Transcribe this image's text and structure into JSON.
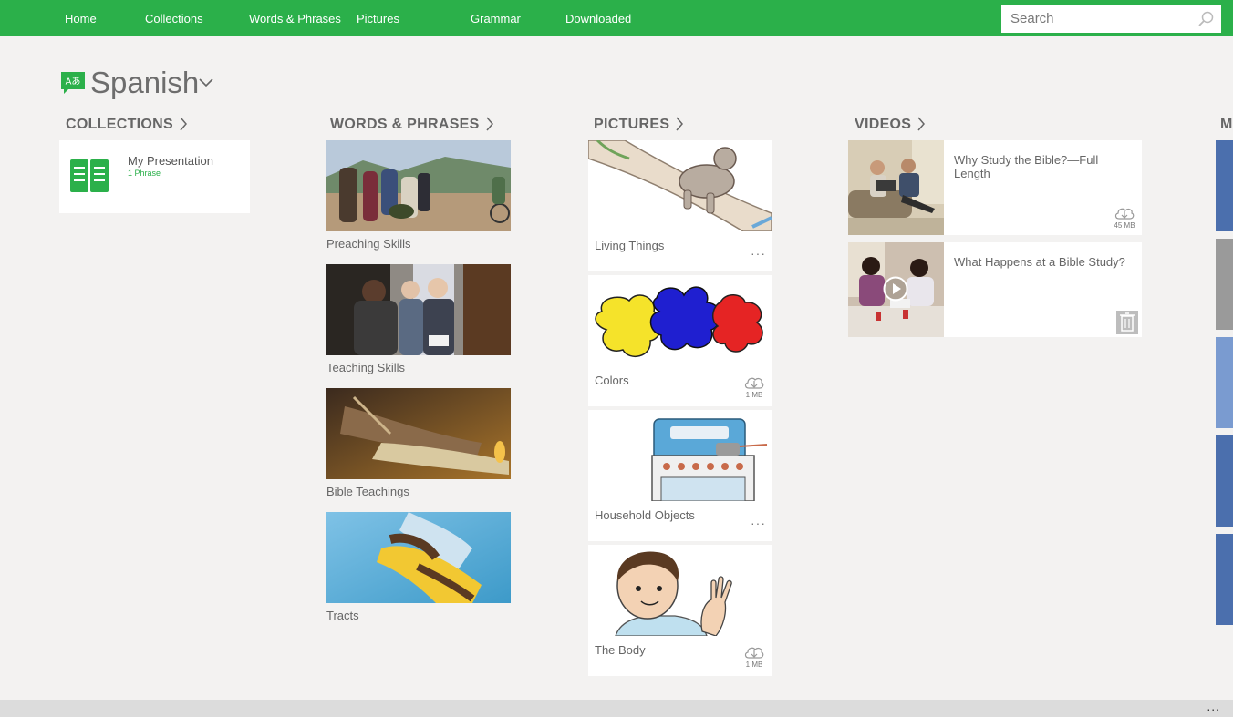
{
  "nav": {
    "items": [
      "Home",
      "Collections",
      "Words & Phrases",
      "Pictures",
      "Grammar",
      "Downloaded"
    ],
    "search_placeholder": "Search"
  },
  "language": {
    "title": "Spanish",
    "icon_text": "Aあ"
  },
  "sections": {
    "collections": "COLLECTIONS",
    "words_phrases": "WORDS & PHRASES",
    "pictures": "PICTURES",
    "videos": "VIDEOS",
    "peek": "M"
  },
  "collections": [
    {
      "name": "My Presentation",
      "count": "1 Phrase"
    }
  ],
  "words_phrases": [
    {
      "label": "Preaching Skills"
    },
    {
      "label": "Teaching Skills"
    },
    {
      "label": "Bible Teachings"
    },
    {
      "label": "Tracts"
    }
  ],
  "pictures": [
    {
      "label": "Living Things",
      "action": "more"
    },
    {
      "label": "Colors",
      "action": "download",
      "size": "1 MB"
    },
    {
      "label": "Household Objects",
      "action": "more"
    },
    {
      "label": "The Body",
      "action": "download",
      "size": "1 MB"
    }
  ],
  "videos": [
    {
      "title": "Why Study the Bible?—Full Length",
      "action": "download",
      "size": "45 MB"
    },
    {
      "title": "What Happens at a Bible Study?",
      "action": "delete"
    }
  ],
  "appbar": {
    "more": "..."
  },
  "colors": {
    "brand_green": "#2bb04a",
    "peek_blue": "#4b6fad"
  }
}
